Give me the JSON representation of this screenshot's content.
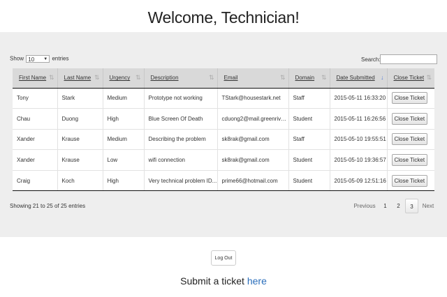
{
  "page": {
    "title": "Welcome, Technician!"
  },
  "table_controls": {
    "show_label": "Show",
    "entries_value": "10",
    "entries_label": "entries",
    "search_label": "Search:",
    "search_value": ""
  },
  "table": {
    "columns": [
      "First Name",
      "Last Name",
      "Urgency",
      "Description",
      "Email",
      "Domain",
      "Date Submitted",
      "Close Ticket"
    ],
    "rows": [
      {
        "first": "Tony",
        "last": "Stark",
        "urgency": "Medium",
        "description": "Prototype not working",
        "email": "TStark@housestark.net",
        "domain": "Staff",
        "date": "2015-05-11 16:33:20",
        "action": "Close Ticket"
      },
      {
        "first": "Chau",
        "last": "Duong",
        "urgency": "High",
        "description": "Blue Screen Of Death",
        "email": "cduong2@mail.greenriver...",
        "domain": "Student",
        "date": "2015-05-11 16:26:56",
        "action": "Close Ticket"
      },
      {
        "first": "Xander",
        "last": "Krause",
        "urgency": "Medium",
        "description": "Describing the problem",
        "email": "sk8rak@gmail.com",
        "domain": "Staff",
        "date": "2015-05-10 19:55:51",
        "action": "Close Ticket"
      },
      {
        "first": "Xander",
        "last": "Krause",
        "urgency": "Low",
        "description": "wifi connection",
        "email": "sk8rak@gmail.com",
        "domain": "Student",
        "date": "2015-05-10 19:36:57",
        "action": "Close Ticket"
      },
      {
        "first": "Craig",
        "last": "Koch",
        "urgency": "High",
        "description": "Very technical problem ID...",
        "email": "prime66@hotmail.com",
        "domain": "Student",
        "date": "2015-05-09 12:51:16",
        "action": "Close Ticket"
      }
    ]
  },
  "footer_info": "Showing 21 to 25 of 25 entries",
  "pagination": {
    "previous": "Previous",
    "pages": [
      "1",
      "2",
      "3"
    ],
    "current": "3",
    "next": "Next"
  },
  "logout_label": "Log Out",
  "submit": {
    "text": "Submit a ticket",
    "link": "here"
  },
  "colors": {
    "panel_bg": "#eeeeee",
    "header_bg": "#d9d9d9",
    "link": "#2a6ebb",
    "sort_active": "#5a7fd6"
  }
}
